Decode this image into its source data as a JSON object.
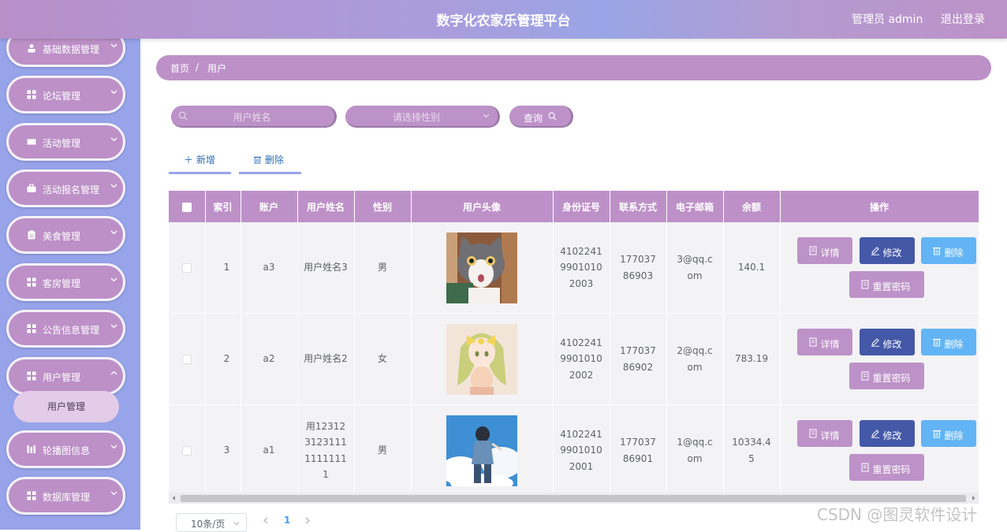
{
  "header": {
    "title": "数字化农家乐管理平台",
    "admin": "管理员 admin",
    "logout": "退出登录"
  },
  "sidebar": {
    "items": [
      {
        "label": "基础数据管理",
        "icon": "user-icon"
      },
      {
        "label": "论坛管理",
        "icon": "grid-icon"
      },
      {
        "label": "活动管理",
        "icon": "ticket-icon"
      },
      {
        "label": "活动报名管理",
        "icon": "briefcase-icon"
      },
      {
        "label": "美食管理",
        "icon": "clipboard-icon"
      },
      {
        "label": "客房管理",
        "icon": "grid-icon"
      },
      {
        "label": "公告信息管理",
        "icon": "grid-icon"
      },
      {
        "label": "用户管理",
        "icon": "grid-icon"
      },
      {
        "label": "轮播图信息",
        "icon": "chart-icon"
      },
      {
        "label": "数据库管理",
        "icon": "grid-icon"
      }
    ],
    "submenu": "用户管理"
  },
  "breadcrumb": {
    "home": "首页",
    "sep": "/",
    "current": "用户"
  },
  "filters": {
    "name_placeholder": "用户姓名",
    "gender_placeholder": "请选择性别",
    "query": "查询"
  },
  "actions": {
    "add": "新增",
    "delete": "删除"
  },
  "table": {
    "columns": [
      "索引",
      "账户",
      "用户姓名",
      "性别",
      "用户头像",
      "身份证号",
      "联系方式",
      "电子邮箱",
      "余额",
      "操作"
    ],
    "rows": [
      {
        "index": "1",
        "account": "a3",
        "name": "用户姓名3",
        "gender": "男",
        "avatar": "gray-white-cat",
        "id_card": "410224199010102003",
        "phone": "17703786903",
        "email": "3@qq.com",
        "balance": "140.1"
      },
      {
        "index": "2",
        "account": "a2",
        "name": "用户姓名2",
        "gender": "女",
        "avatar": "anime-girl-yellow-bow",
        "id_card": "410224199010102002",
        "phone": "17703786902",
        "email": "2@qq.com",
        "balance": "783.19"
      },
      {
        "index": "3",
        "account": "a1",
        "name": "用12312312311111111111",
        "gender": "男",
        "avatar": "anime-boy-sky",
        "id_card": "410224199010102001",
        "phone": "17703786901",
        "email": "1@qq.com",
        "balance": "10334.45"
      }
    ],
    "row_actions": {
      "detail": "详情",
      "edit": "修改",
      "delete": "删除",
      "reset": "重置密码"
    }
  },
  "pagination": {
    "page_size": "10条/页",
    "current_page": "1"
  },
  "watermark": "CSDN @图灵软件设计"
}
